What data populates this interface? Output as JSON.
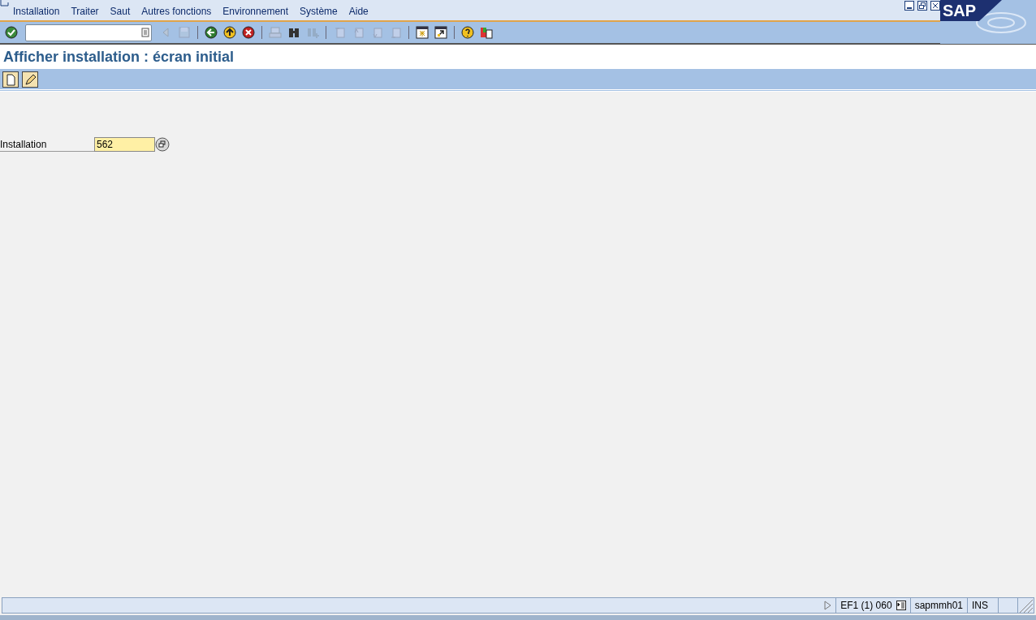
{
  "menu": [
    {
      "label": "Installation"
    },
    {
      "label": "Traiter"
    },
    {
      "label": "Saut"
    },
    {
      "label": "Autres fonctions"
    },
    {
      "label": "Environnement"
    },
    {
      "label": "Système"
    },
    {
      "label": "Aide"
    }
  ],
  "toolbar": [
    {
      "kind": "enter",
      "disabled": false
    },
    {
      "kind": "command"
    },
    {
      "kind": "prev",
      "disabled": true
    },
    {
      "kind": "save",
      "disabled": true
    },
    {
      "kind": "sep"
    },
    {
      "kind": "back",
      "disabled": false
    },
    {
      "kind": "exit",
      "disabled": false
    },
    {
      "kind": "cancel",
      "disabled": false
    },
    {
      "kind": "sep"
    },
    {
      "kind": "print",
      "disabled": true
    },
    {
      "kind": "find",
      "disabled": false
    },
    {
      "kind": "findnext",
      "disabled": true
    },
    {
      "kind": "sep"
    },
    {
      "kind": "first",
      "disabled": true
    },
    {
      "kind": "pageup",
      "disabled": true
    },
    {
      "kind": "pagedown",
      "disabled": true
    },
    {
      "kind": "last",
      "disabled": true
    },
    {
      "kind": "sep"
    },
    {
      "kind": "newsession",
      "disabled": false
    },
    {
      "kind": "shortcut",
      "disabled": false
    },
    {
      "kind": "sep"
    },
    {
      "kind": "help",
      "disabled": false
    },
    {
      "kind": "layout",
      "disabled": false
    }
  ],
  "logo": "SAP",
  "title": "Afficher installation : écran initial",
  "app_toolbar": [
    {
      "kind": "create"
    },
    {
      "kind": "edit"
    }
  ],
  "field": {
    "label": "Installation",
    "value": "562"
  },
  "status_bar": {
    "system": "EF1 (1) 060",
    "server": "sapmmh01",
    "mode": "INS"
  }
}
